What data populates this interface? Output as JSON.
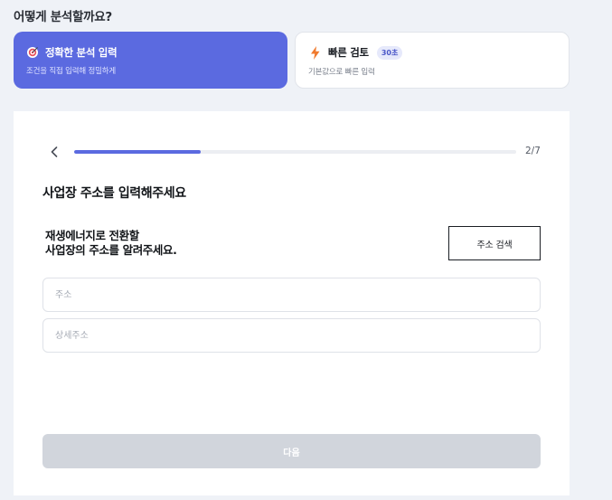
{
  "analysis": {
    "question": "어떻게 분석할까요?",
    "modes": [
      {
        "title": "정확한 분석 입력",
        "subtitle": "조건을 직접 입력해 정밀하게",
        "icon": "target-icon",
        "selected": true
      },
      {
        "title": "빠른 검토",
        "badge": "30초",
        "subtitle": "기본값으로 빠른 입력",
        "icon": "lightning-icon",
        "selected": false
      }
    ]
  },
  "wizard": {
    "step_label": "2/7",
    "progress_fraction": 0.286,
    "title": "사업장 주소를 입력해주세요",
    "description": [
      "재생에너지로 전환할",
      "사업장의 주소를 알려주세요."
    ],
    "search_button": "주소 검색",
    "address_input": {
      "placeholder": "주소",
      "value": ""
    },
    "detail_input": {
      "placeholder": "상세주소",
      "value": ""
    },
    "next_button": "다음"
  },
  "colors": {
    "accent": "#5b6ae0",
    "page_background": "#eff2f7",
    "disabled_button": "#d1d5dc",
    "badge_background": "#e6e9fb",
    "lightning": "#f07a2e"
  }
}
